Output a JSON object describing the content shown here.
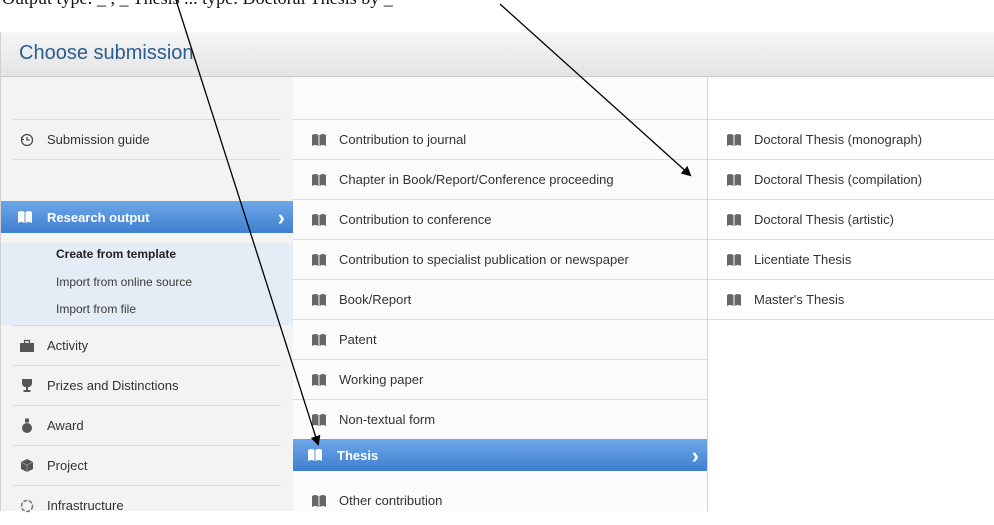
{
  "caption_fragment": "Output type: _ , _ Thesis ... type: Doctoral Thesis by _",
  "header": {
    "title": "Choose submission"
  },
  "left_column": {
    "guide": {
      "label": "Submission guide",
      "icon": "clock-icon"
    },
    "selected": {
      "label": "Research output",
      "icon": "book-icon"
    },
    "sub_items": [
      {
        "label": "Create from template"
      },
      {
        "label": "Import from online source"
      },
      {
        "label": "Import from file"
      }
    ],
    "items": [
      {
        "label": "Activity",
        "icon": "briefcase-icon"
      },
      {
        "label": "Prizes and Distinctions",
        "icon": "trophy-icon"
      },
      {
        "label": "Award",
        "icon": "medal-icon"
      },
      {
        "label": "Project",
        "icon": "cube-icon"
      },
      {
        "label": "Infrastructure",
        "icon": "circle-icon"
      }
    ]
  },
  "middle_column": {
    "items": [
      {
        "label": "Contribution to journal"
      },
      {
        "label": "Chapter in Book/Report/Conference proceeding"
      },
      {
        "label": "Contribution to conference"
      },
      {
        "label": "Contribution to specialist publication or newspaper"
      },
      {
        "label": "Book/Report"
      },
      {
        "label": "Patent"
      },
      {
        "label": "Working paper"
      },
      {
        "label": "Non-textual form"
      }
    ],
    "selected": {
      "label": "Thesis"
    },
    "after": [
      {
        "label": "Other contribution"
      }
    ]
  },
  "right_column": {
    "items": [
      {
        "label": "Doctoral Thesis (monograph)"
      },
      {
        "label": "Doctoral Thesis (compilation)"
      },
      {
        "label": "Doctoral Thesis (artistic)"
      },
      {
        "label": "Licentiate Thesis"
      },
      {
        "label": "Master's Thesis"
      }
    ]
  },
  "colors": {
    "accent": "#3f7fd1",
    "title": "#2a5d8f",
    "subpanel": "#e4edf6"
  }
}
